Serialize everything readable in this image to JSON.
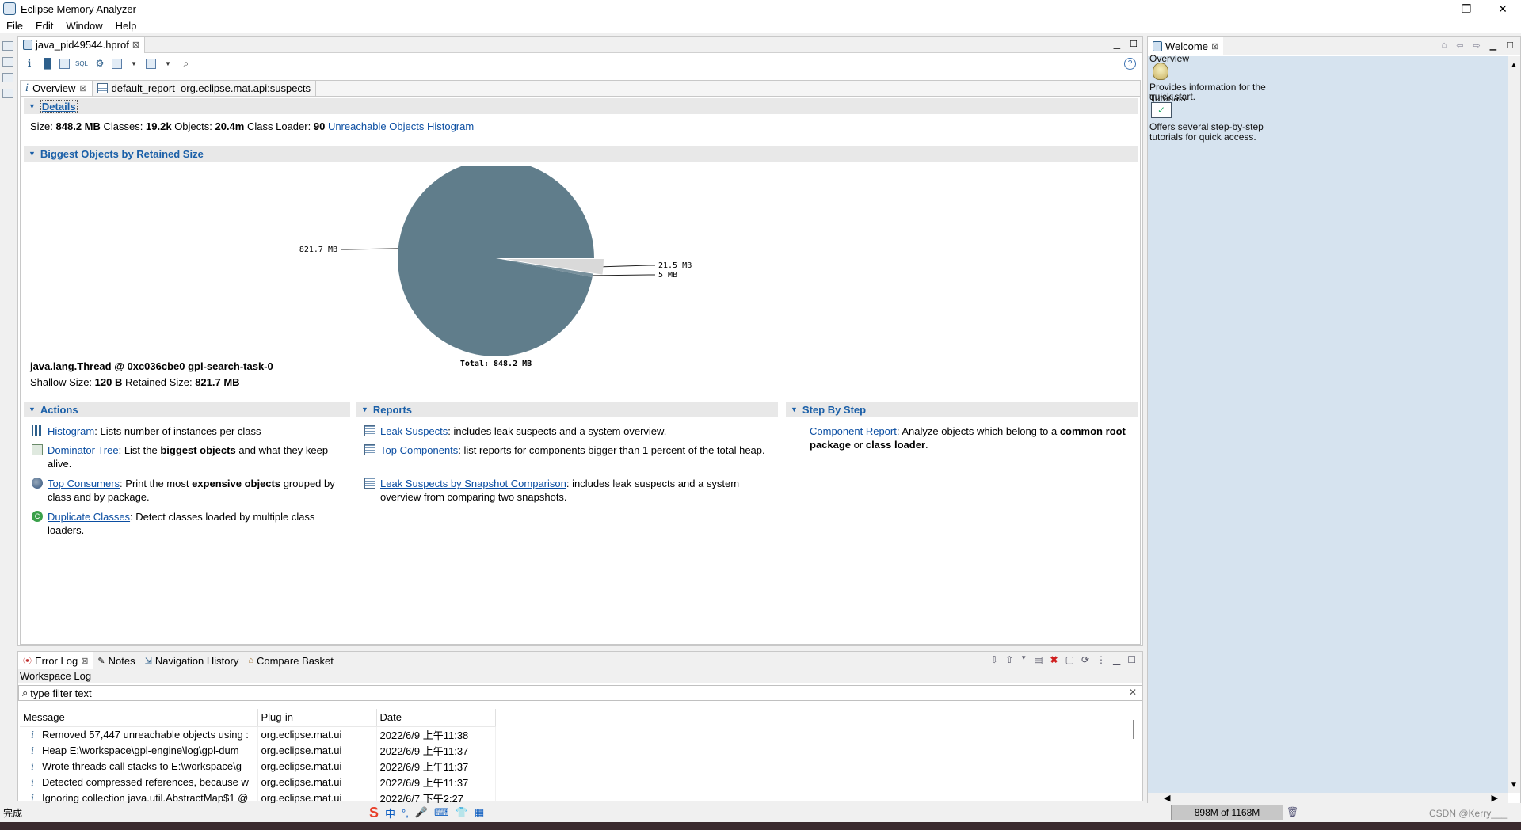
{
  "window": {
    "title": "Eclipse Memory Analyzer",
    "minimize": "—",
    "restore": "❐",
    "close": "✕"
  },
  "menu": [
    "File",
    "Edit",
    "Window",
    "Help"
  ],
  "editor": {
    "tab_label": "java_pid49544.hprof",
    "inner_tabs": [
      {
        "label": "Overview"
      },
      {
        "label": "default_report  org.eclipse.mat.api:suspects"
      }
    ],
    "details": {
      "heading": "Details",
      "size_label": "Size:",
      "size": "848.2 MB",
      "classes_label": "Classes:",
      "classes": "19.2k",
      "objects_label": "Objects:",
      "objects": "20.4m",
      "loader_label": "Class Loader:",
      "loader": "90",
      "unreachable_link": "Unreachable Objects Histogram"
    },
    "biggest": {
      "heading": "Biggest Objects by Retained Size",
      "object": "java.lang.Thread @ 0xc036cbe0 gpl-search-task-0",
      "shallow_label": "Shallow Size:",
      "shallow": "120 B",
      "retained_label": "Retained Size:",
      "retained": "821.7 MB"
    },
    "actions": {
      "heading": "Actions",
      "histogram_link": "Histogram",
      "histogram_desc": ": Lists number of instances per class",
      "dominator_link": "Dominator Tree",
      "dominator_desc1": ": List the ",
      "dominator_bold": "biggest objects",
      "dominator_desc2": " and what they keep alive.",
      "consumers_link": "Top Consumers",
      "consumers_desc1": ": Print the most ",
      "consumers_bold": "expensive objects",
      "consumers_desc2": " grouped by class and by package.",
      "duplicate_link": "Duplicate Classes",
      "duplicate_desc": ": Detect classes loaded by multiple class loaders."
    },
    "reports": {
      "heading": "Reports",
      "leak_link": "Leak Suspects",
      "leak_desc": ": includes leak suspects and a system overview.",
      "topcomp_link": "Top Components",
      "topcomp_desc": ": list reports for components bigger than 1 percent of the total heap.",
      "snap_link": "Leak Suspects by Snapshot Comparison",
      "snap_desc": ": includes leak suspects and a system overview from comparing two snapshots."
    },
    "step": {
      "heading": "Step By Step",
      "comp_link": "Component Report",
      "comp_desc1": ": Analyze objects which belong to a ",
      "comp_bold1": "common root package",
      "comp_desc2": " or ",
      "comp_bold2": "class loader",
      "comp_desc3": "."
    }
  },
  "chart_data": {
    "type": "pie",
    "slices": [
      {
        "label": "821.7 MB",
        "value": 821.7,
        "color": "#607d8b"
      },
      {
        "label": "21.5 MB",
        "value": 21.5,
        "color": "#d9d9d9"
      },
      {
        "label": "5 MB",
        "value": 5,
        "color": "#78909c"
      }
    ],
    "total_label": "Total: 848.2 MB"
  },
  "bottom": {
    "tabs": [
      {
        "label": "Error Log"
      },
      {
        "label": "Notes"
      },
      {
        "label": "Navigation History"
      },
      {
        "label": "Compare Basket"
      }
    ],
    "workspace_log": "Workspace Log",
    "filter_placeholder": "type filter text",
    "columns": [
      "Message",
      "Plug-in",
      "Date"
    ],
    "rows": [
      {
        "message": "Removed 57,447 unreachable objects using :",
        "plugin": "org.eclipse.mat.ui",
        "date": "2022/6/9 上午11:38"
      },
      {
        "message": "Heap E:\\workspace\\gpl-engine\\log\\gpl-dum",
        "plugin": "org.eclipse.mat.ui",
        "date": "2022/6/9 上午11:37"
      },
      {
        "message": "Wrote threads call stacks to E:\\workspace\\g",
        "plugin": "org.eclipse.mat.ui",
        "date": "2022/6/9 上午11:37"
      },
      {
        "message": "Detected compressed references, because w",
        "plugin": "org.eclipse.mat.ui",
        "date": "2022/6/9 上午11:37"
      },
      {
        "message": "Ignoring collection java.util.AbstractMap$1 @",
        "plugin": "org.eclipse.mat.ui",
        "date": "2022/6/7 下午2:27"
      }
    ]
  },
  "welcome": {
    "tab_label": "Welcome",
    "overview_title": "Overview",
    "overview_desc1": "Provides information for the",
    "overview_desc2": "quick start.",
    "tutorials_title": "Tutorials",
    "tutorials_desc1": "Offers several step-by-step",
    "tutorials_desc2": "tutorials for quick access."
  },
  "status": {
    "left": "完成",
    "memory": "898M of 1168M",
    "ime": [
      "中",
      "°,",
      "🎤",
      "⌨",
      "👕",
      "▦"
    ],
    "watermark": "CSDN @Kerry___"
  }
}
